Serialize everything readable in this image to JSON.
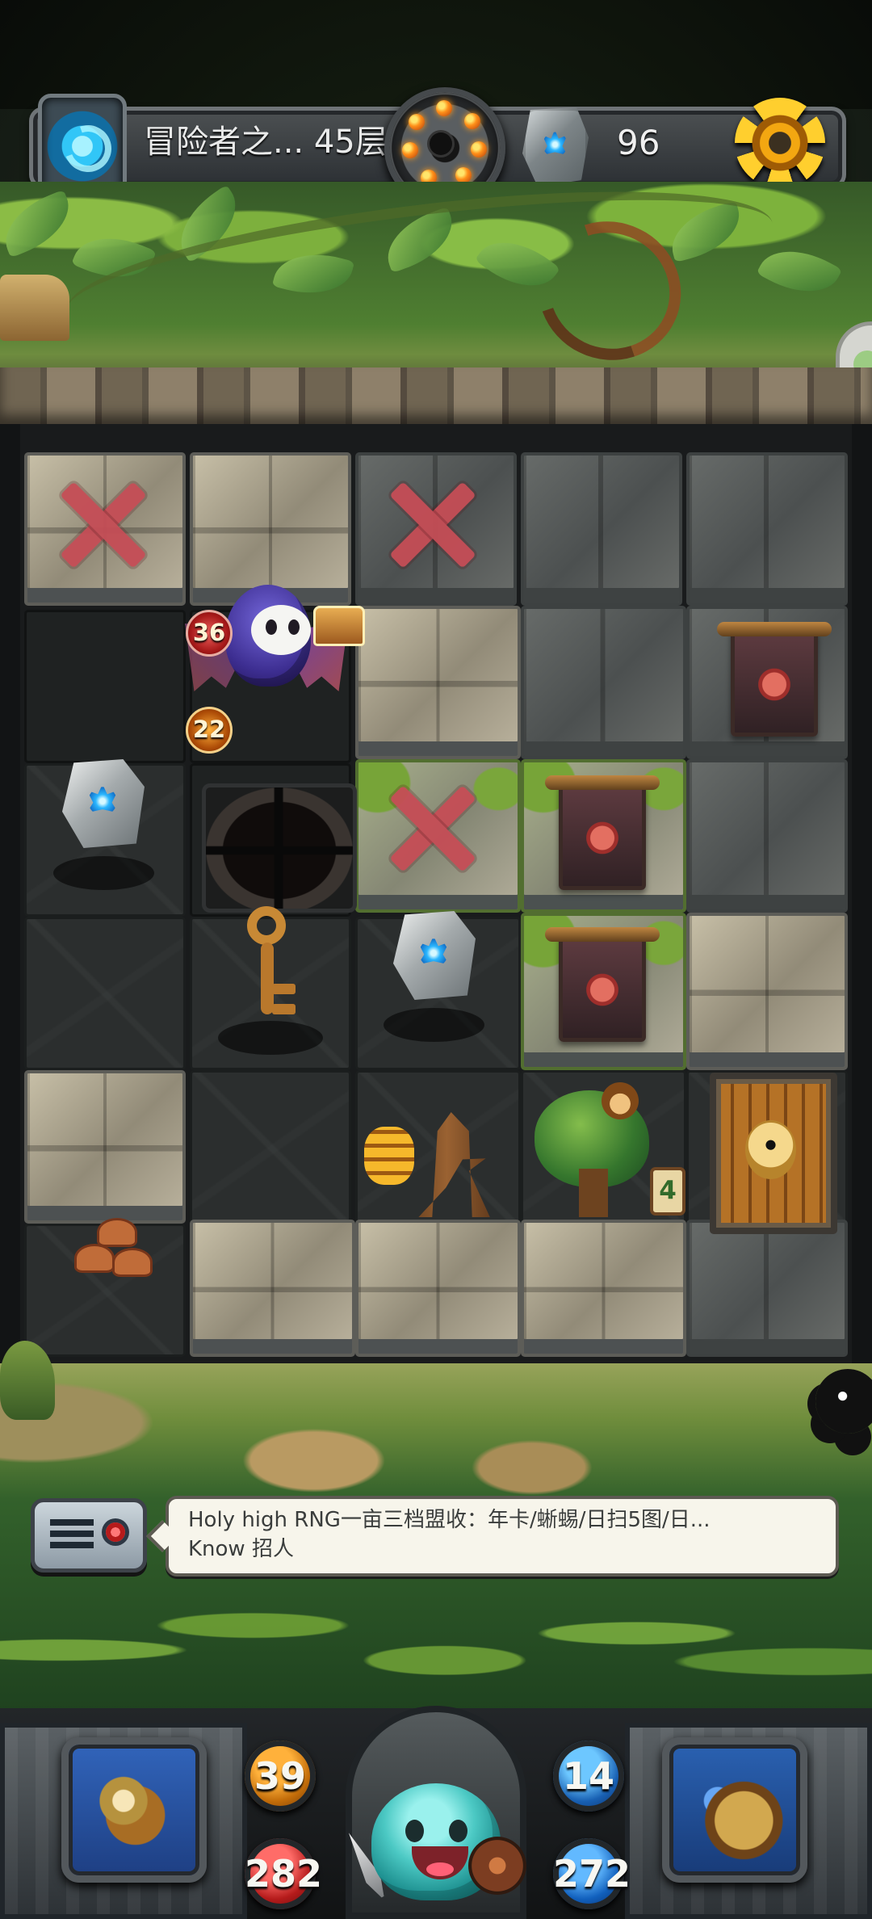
{
  "top_bar": {
    "floor_label": "冒险者之... 45层",
    "currency_count": "96",
    "portal_icon": "portal-icon",
    "bomb_icon": "bomb-wheel-icon",
    "stone_icon": "rune-stone-icon",
    "settings_icon": "gear-icon"
  },
  "board": {
    "monster_stats": {
      "attack": "36",
      "health": "22"
    },
    "door_counter": "4"
  },
  "chat": {
    "line_1": "Holy high RNG一亩三档盟收：年卡/蜥蜴/日扫5图/日...",
    "line_2": "Know 招人",
    "icon": "chat-radio-icon"
  },
  "player": {
    "attack": "39",
    "health_left": "282",
    "defense": "14",
    "health_right": "272",
    "equipment_icon": "equipment-icon",
    "book_icon": "spellbook-icon"
  },
  "colors": {
    "forest": "#4f7f31",
    "stone": "#928b78",
    "blocked_mark": "#c54d56",
    "gold": "#f3a711"
  }
}
